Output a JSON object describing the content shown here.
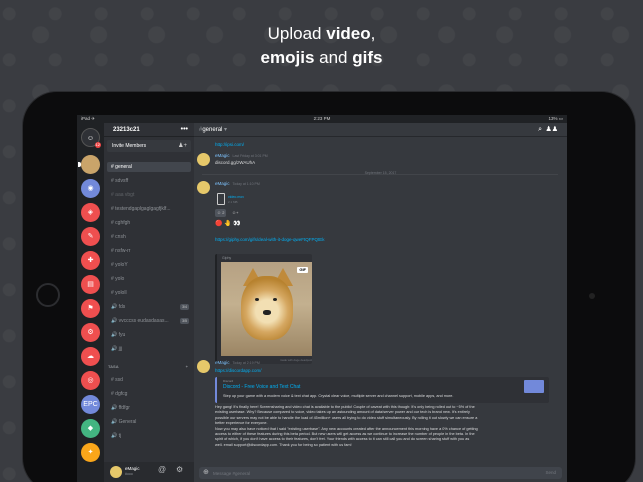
{
  "headline": {
    "line1_pre": "Upload ",
    "line1_bold": "video",
    "line1_post": ",",
    "line2_bold1": "emojis",
    "line2_mid": " and ",
    "line2_bold2": "gifs"
  },
  "statusbar": {
    "left": "iPad ✈",
    "time": "2:23 PM",
    "right": "13% ▭"
  },
  "server": {
    "name": "23213c21",
    "more": "•••",
    "invite_label": "Invite Members"
  },
  "channels": [
    {
      "label": "# general",
      "active": true,
      "count": ""
    },
    {
      "label": "# sdvsff",
      "active": false,
      "count": ""
    },
    {
      "label": "# aaa vbgt",
      "active": false,
      "count": ""
    },
    {
      "label": "# testendgaplgaglgagfjklf...",
      "active": false,
      "count": ""
    },
    {
      "label": "# cghfgh",
      "active": false,
      "count": ""
    },
    {
      "label": "# cnsh",
      "active": false,
      "count": ""
    },
    {
      "label": "# nsfw-rr",
      "active": false,
      "count": ""
    },
    {
      "label": "# yoloY",
      "active": false,
      "count": ""
    },
    {
      "label": "# yolo",
      "active": false,
      "count": ""
    },
    {
      "label": "# yololl",
      "active": false,
      "count": ""
    },
    {
      "label": "🔊 fds",
      "active": false,
      "count": "3/4"
    },
    {
      "label": "🔊 vvcccss eudasdasas...",
      "active": false,
      "count": "3/5"
    },
    {
      "label": "🔊 fyu",
      "active": false,
      "count": ""
    },
    {
      "label": "🔊 jjj",
      "active": false,
      "count": ""
    }
  ],
  "category": {
    "name": "TASA",
    "plus": "+"
  },
  "channels2": [
    {
      "label": "# ssd"
    },
    {
      "label": "# dgfcg"
    },
    {
      "label": "🔊 ffdfgr"
    },
    {
      "label": "🔊 General"
    },
    {
      "label": "🔊 tj"
    }
  ],
  "user": {
    "name": "eMagic",
    "status": "#ooo"
  },
  "chat": {
    "channel": "general",
    "link_top": "http://ipsi.com/",
    "msg1_author": "eMagic",
    "msg1_time": "Last Friday at 3:01 PM",
    "msg1_text": "discord.gg/zWAUhA",
    "date_divider": "September 15, 2017",
    "msg2_author": "eMagic",
    "msg2_time": "Today at 1:10 PM",
    "file_name": "video.mov",
    "file_size": "2.1 MB",
    "reaction_count": "2",
    "gif_link": "https://giphy.com/gifs/deal-with-it-doge-qweFtQFPQtEk",
    "gif_provider": "Giphy",
    "gif_badge": "GIF",
    "gif_caption": "made with doge deadpool",
    "msg3_author": "eMagic",
    "msg3_time": "Today at 2:19 PM",
    "site_link": "https://discordapp.com/",
    "embed_provider": "Discord",
    "embed_title": "Discord - Free Voice and Text Chat",
    "embed_desc": "Step up your game with a modern voice & text chat app. Crystal clear voice, multiple server and channel support, mobile apps, and more.",
    "body_lines": [
      "Hey gang! It's finally here! Screensharing and video chat is available to the public! Couple of caveat with this though: It's only being rolled out to ~5% of the",
      "existing userbase. Why? Because compared to voice, video takes up an astounding amount of data/server power and our tech is brand new. It's entirely",
      "possible our servers may not be able to handle the load of 45million+ users all trying to do video stuff simultaneously. By rolling it out slowly we can ensure a",
      "better experience for everyone.",
      "Now you may also have noticed that I said \"existing userbase\". Any new accounts created after the announcement this morning have a 0% chance of getting",
      "access to either of these features during this beta period. But new users will get access as we continue to increase the number of people in the beta. In the",
      "spirit of which, if you don't have access to their features, don't fret. Your friends with access to it can still call you and do screen sharing stuff with you as",
      "well. email support@discordapp.com. Thank you for being so patient with us fam!"
    ],
    "input_placeholder": "Message #general",
    "send_label": "Send"
  },
  "colors": {
    "accent": "#7289da",
    "link": "#00b0f4",
    "background": "#36393e"
  }
}
